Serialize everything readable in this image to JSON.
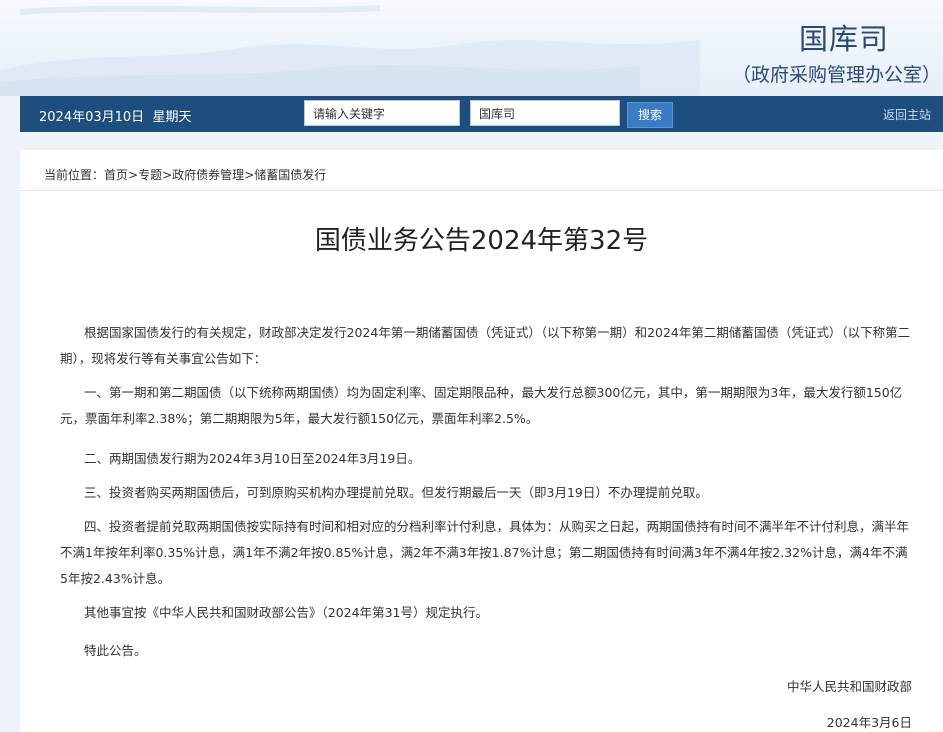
{
  "header": {
    "title": "国库司",
    "subtitle": "（政府采购管理办公室）"
  },
  "nav": {
    "date": "2024年03月10日",
    "weekday": "星期天",
    "search_placeholder": "请输入关键字",
    "scope_value": "国库司",
    "search_label": "搜索",
    "home_label": "返回主站"
  },
  "breadcrumb": {
    "prefix": "当前位置：",
    "items": [
      "首页",
      "专题",
      "政府债券管理",
      "储蓄国债发行"
    ],
    "separator": ">"
  },
  "article": {
    "title": "国债业务公告2024年第32号",
    "paragraphs": [
      "根据国家国债发行的有关规定，财政部决定发行2024年第一期储蓄国债（凭证式）（以下称第一期）和2024年第二期储蓄国债（凭证式）（以下称第二期），现将发行等有关事宜公告如下：",
      "一、第一期和第二期国债（以下统称两期国债）均为固定利率、固定期限品种，最大发行总额300亿元，其中，第一期期限为3年，最大发行额150亿元，票面年利率2.38%；第二期期限为5年，最大发行额150亿元，票面年利率2.5%。",
      "二、两期国债发行期为2024年3月10日至2024年3月19日。",
      "三、投资者购买两期国债后，可到原购买机构办理提前兑取。但发行期最后一天（即3月19日）不办理提前兑取。",
      "四、投资者提前兑取两期国债按实际持有时间和相对应的分档利率计付利息，具体为：从购买之日起，两期国债持有时间不满半年不计付利息，满半年不满1年按年利率0.35%计息，满1年不满2年按0.85%计息，满2年不满3年按1.87%计息；第二期国债持有时间满3年不满4年按2.32%计息，满4年不满5年按2.43%计息。",
      "其他事宜按《中华人民共和国财政部公告》（2024年第31号）规定执行。",
      "特此公告。"
    ],
    "issuer": "中华人民共和国财政部",
    "date": "2024年3月6日"
  }
}
